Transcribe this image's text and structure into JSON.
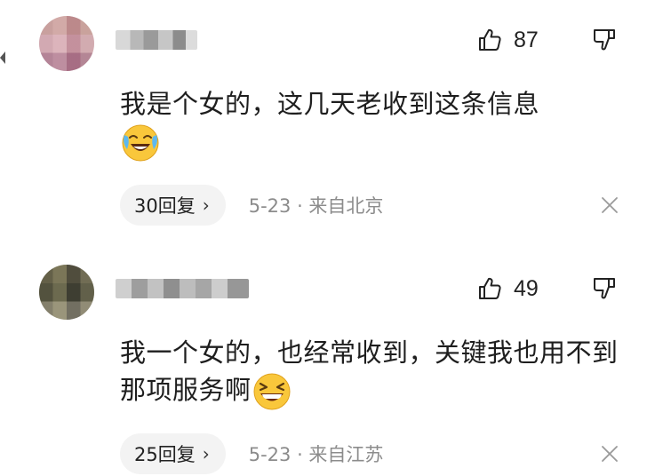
{
  "comments": [
    {
      "avatar_icon": "user-avatar",
      "likes": "87",
      "text": "我是个女的，这几天老收到这条信息",
      "emoji": "laughing-crying-emoji",
      "reply_label": "30回复",
      "reply_chevron": "›",
      "meta": "5-23 · 来自北京"
    },
    {
      "avatar_icon": "user-avatar",
      "likes": "49",
      "text": "我一个女的，也经常收到，关键我也用不到那项服务啊",
      "emoji": "grinning-squint-emoji",
      "reply_label": "25回复",
      "reply_chevron": "›",
      "meta": "5-23 · 来自江苏"
    }
  ],
  "icons": {
    "like": "thumbs-up-icon",
    "dislike": "thumbs-down-icon",
    "close": "close-icon"
  },
  "colors": {
    "text": "#1e1e1e",
    "meta": "#8c8c8c",
    "pill_background": "#f3f3f3",
    "icon_stroke": "#222222"
  }
}
